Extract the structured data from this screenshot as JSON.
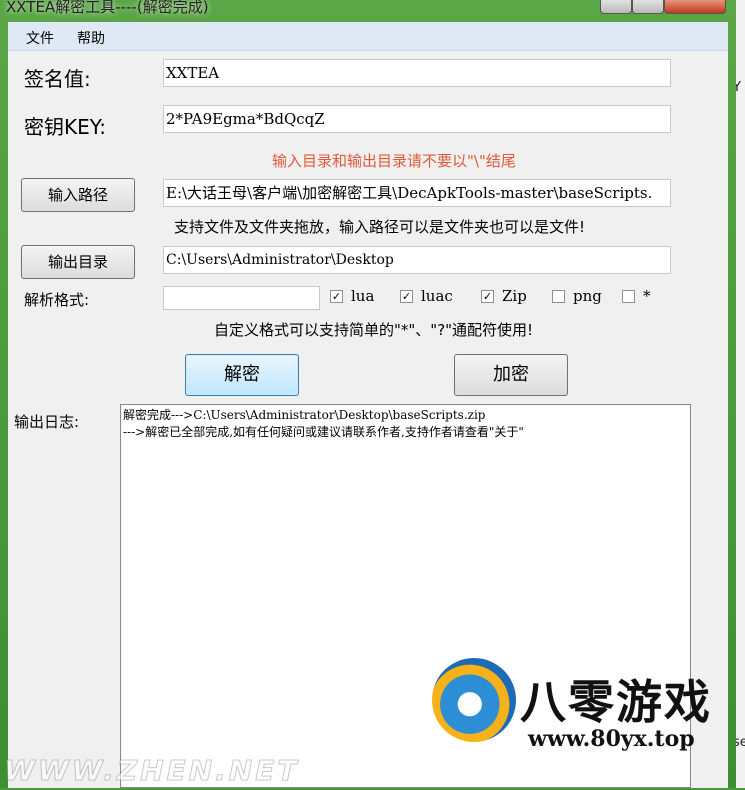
{
  "window": {
    "title": "XXTEA解密工具----(解密完成)"
  },
  "menu": {
    "file": "文件",
    "help": "帮助"
  },
  "form": {
    "sign_label": "签名值:",
    "sign_value": "XXTEA",
    "key_label": "密钥KEY:",
    "key_value": "2*PA9Egma*BdQcqZ",
    "warning": "输入目录和输出目录请不要以\"\\\"结尾",
    "input_button": "输入路径",
    "input_value": "E:\\大话王母\\客户端\\加密解密工具\\DecApkTools-master\\baseScripts.",
    "drag_hint": "支持文件及文件夹拖放，输入路径可以是文件夹也可以是文件!",
    "output_button": "输出目录",
    "output_value": "C:\\Users\\Administrator\\Desktop",
    "format_label": "解析格式:",
    "format_value": "",
    "formats": [
      {
        "label": "lua",
        "checked": true
      },
      {
        "label": "luac",
        "checked": true
      },
      {
        "label": "Zip",
        "checked": true
      },
      {
        "label": "png",
        "checked": false
      },
      {
        "label": "*",
        "checked": false
      }
    ],
    "wildcard_hint": "自定义格式可以支持简单的\"*\"、\"?\"通配符使用!"
  },
  "actions": {
    "decrypt": "解密",
    "encrypt": "加密"
  },
  "log": {
    "label": "输出日志:",
    "lines": [
      "解密完成--->C:\\Users\\Administrator\\Desktop\\baseScripts.zip",
      "--->解密已全部完成,如有任何疑问或建议请联系作者,支持作者请查看\"关于\""
    ]
  },
  "watermark": {
    "brand": "八零游戏",
    "url": "www.80yx.top",
    "site": "WWW.ZHEN.NET"
  },
  "background": {
    "frag1": "Y",
    "frag2": "se"
  },
  "colors": {
    "accent": "#3c7fb1",
    "warning": "#e05a3a",
    "window_frame": "#4a9a3c"
  }
}
